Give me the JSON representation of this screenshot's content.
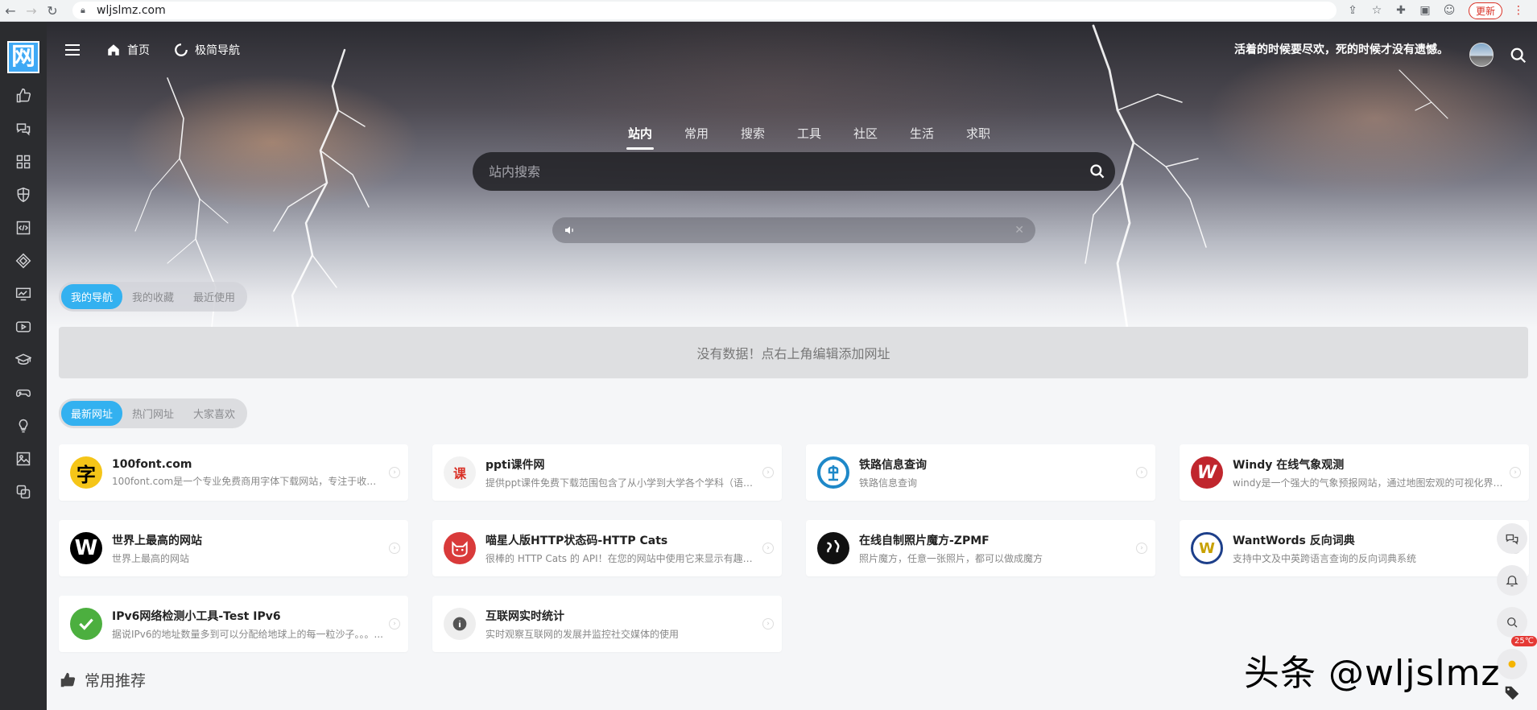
{
  "browser": {
    "url": "wljslmz.com",
    "update_label": "更新"
  },
  "sidebar": {
    "logo_text": "网",
    "items": [
      {
        "icon": "thumbs-up-icon"
      },
      {
        "icon": "chat-bubbles-icon"
      },
      {
        "icon": "grid-icon"
      },
      {
        "icon": "shield-icon"
      },
      {
        "icon": "code-file-icon"
      },
      {
        "icon": "diamond-nodes-icon"
      },
      {
        "icon": "monitor-chart-icon"
      },
      {
        "icon": "video-play-icon"
      },
      {
        "icon": "graduation-cap-icon"
      },
      {
        "icon": "gamepad-icon"
      },
      {
        "icon": "lightbulb-icon"
      },
      {
        "icon": "image-icon"
      },
      {
        "icon": "copy-icon"
      }
    ]
  },
  "topbar": {
    "home_label": "首页",
    "fast_nav_label": "极简导航",
    "slogan": "活着的时候要尽欢，死的时候才没有遗憾。"
  },
  "search": {
    "tabs": [
      "站内",
      "常用",
      "搜索",
      "工具",
      "社区",
      "生活",
      "求职"
    ],
    "active_tab": 0,
    "placeholder": "站内搜索"
  },
  "my_nav": {
    "tabs": [
      "我的导航",
      "我的收藏",
      "最近使用"
    ],
    "empty_text": "没有数据！点右上角编辑添加网址"
  },
  "latest": {
    "tabs": [
      "最新网址",
      "热门网址",
      "大家喜欢"
    ],
    "cards": [
      {
        "title": "100font.com",
        "desc": "100font.com是一个专业免费商用字体下载网站，专注于收集整理..."
      },
      {
        "title": "ppti课件网",
        "desc": "提供ppt课件免费下载范围包含了从小学到大学各个学科（语文..."
      },
      {
        "title": "铁路信息查询",
        "desc": "铁路信息查询"
      },
      {
        "title": "Windy 在线气象观测",
        "desc": "windy是一个强大的气象预报网站，通过地图宏观的可视化界面..."
      },
      {
        "title": "世界上最高的网站",
        "desc": "世界上最高的网站"
      },
      {
        "title": "喵星人版HTTP状态码-HTTP Cats",
        "desc": "很棒的 HTTP Cats 的 API！在您的网站中使用它来显示有趣的错..."
      },
      {
        "title": "在线自制照片魔方-ZPMF",
        "desc": "照片魔方，任意一张照片，都可以做成魔方"
      },
      {
        "title": "WantWords 反向词典",
        "desc": "支持中文及中英跨语言查询的反向词典系统"
      },
      {
        "title": "IPv6网络检测小工具-Test IPv6",
        "desc": "据说IPv6的地址数量多到可以分配给地球上的每一粒沙子。。。..."
      },
      {
        "title": "互联网实时统计",
        "desc": "实时观察互联网的发展并监控社交媒体的使用"
      }
    ]
  },
  "recommend": {
    "title": "常用推荐"
  },
  "weather": {
    "temp": "25℃"
  },
  "watermark": "头条 @wljslmz"
}
